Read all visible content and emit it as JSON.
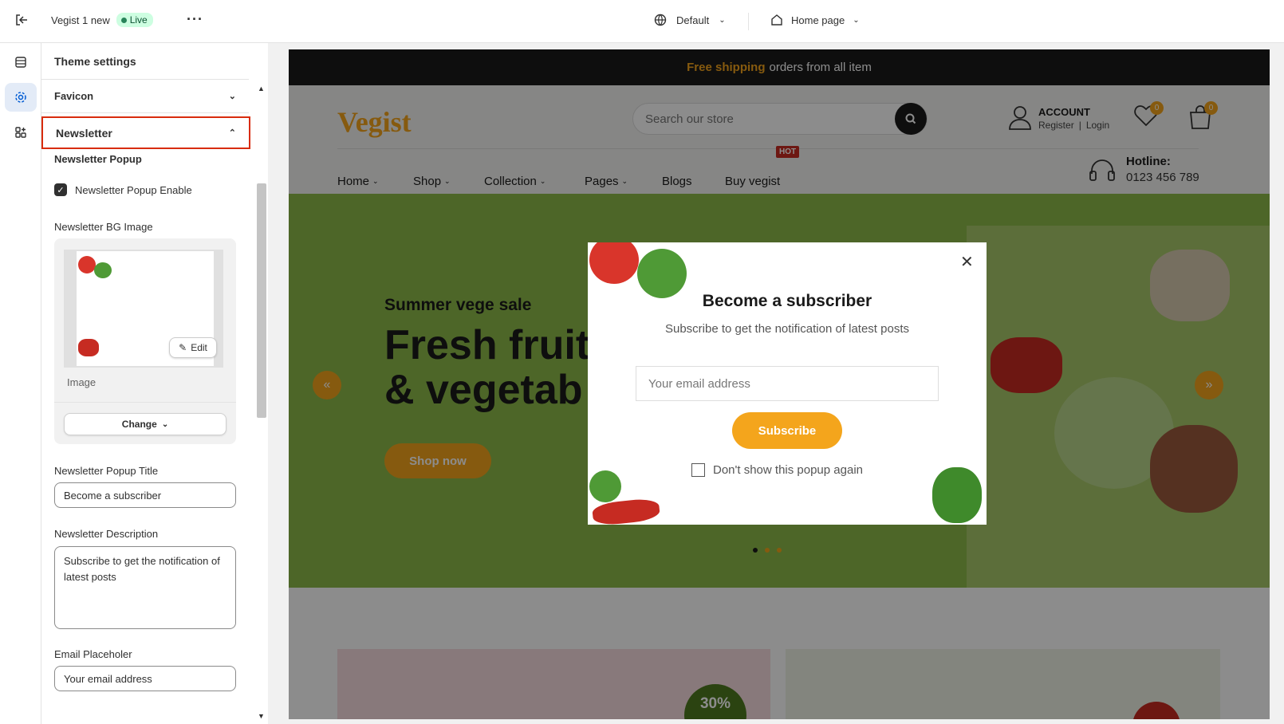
{
  "topbar": {
    "exit_icon": "exit-icon",
    "theme_name": "Vegist 1 new",
    "status": "Live",
    "more_icon": "more-icon",
    "locale": "Default",
    "page": "Home page"
  },
  "rail": {
    "items": [
      "sections-icon",
      "gear-icon",
      "apps-icon"
    ],
    "active": "gear-icon"
  },
  "panel": {
    "header": "Theme settings",
    "favicon": "Favicon",
    "newsletter": "Newsletter",
    "newsletter_popup": "Newsletter Popup",
    "enable_label": "Newsletter Popup Enable",
    "enable_checked": true,
    "bg_image_label": "Newsletter BG Image",
    "edit_label": "Edit",
    "image_caption": "Image",
    "change_label": "Change",
    "title_label": "Newsletter Popup Title",
    "title_value": "Become a subscriber",
    "desc_label": "Newsletter Description",
    "desc_value": "Subscribe to get the notification of latest posts",
    "email_label": "Email Placeholer",
    "email_value": "Your email address"
  },
  "store": {
    "announcement_highlight": "Free shipping",
    "announcement_rest": "orders from all item",
    "logo": "Vegist",
    "search_placeholder": "Search our store",
    "account_title": "ACCOUNT",
    "register": "Register",
    "login": "Login",
    "wishlist_count": "0",
    "cart_count": "0",
    "nav": [
      "Home",
      "Shop",
      "Collection",
      "Pages",
      "Blogs",
      "Buy vegist"
    ],
    "hot_badge": "HOT",
    "hotline_label": "Hotline:",
    "hotline_number": "0123 456 789",
    "hero_kicker": "Summer vege sale",
    "hero_title_1": "Fresh fruit",
    "hero_title_2": "& vegetab",
    "shop_now": "Shop now",
    "promo_badge": "30%"
  },
  "popup": {
    "title": "Become a subscriber",
    "description": "Subscribe to get the notification of latest posts",
    "email_placeholder": "Your email address",
    "subscribe": "Subscribe",
    "dont_show": "Don't show this popup again"
  },
  "colors": {
    "accent": "#f4a51c",
    "hero_green": "#8dbb4a",
    "highlight_border": "#d82c0d",
    "live_green": "#29845a"
  }
}
